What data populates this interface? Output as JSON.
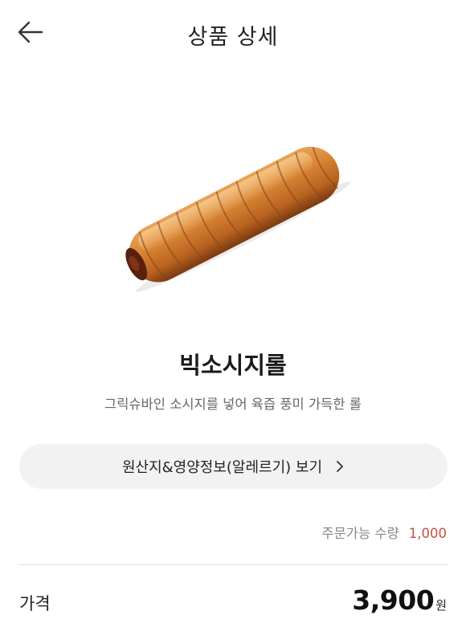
{
  "header": {
    "title": "상품 상세",
    "back_icon": "arrow-left-icon"
  },
  "product": {
    "image": "sausage-roll-bread",
    "name": "빅소시지롤",
    "description": "그릭슈바인 소시지를 넣어 육즙 풍미 가득한 롤"
  },
  "info_button": {
    "label": "원산지&영양정보(알레르기) 보기",
    "icon": "chevron-right-icon"
  },
  "order": {
    "label": "주문가능 수량",
    "quantity": "1,000"
  },
  "price": {
    "label": "가격",
    "value": "3,900",
    "unit": "원"
  },
  "colors": {
    "accent": "#c94f3f",
    "pill_background": "#f2f2f2"
  }
}
